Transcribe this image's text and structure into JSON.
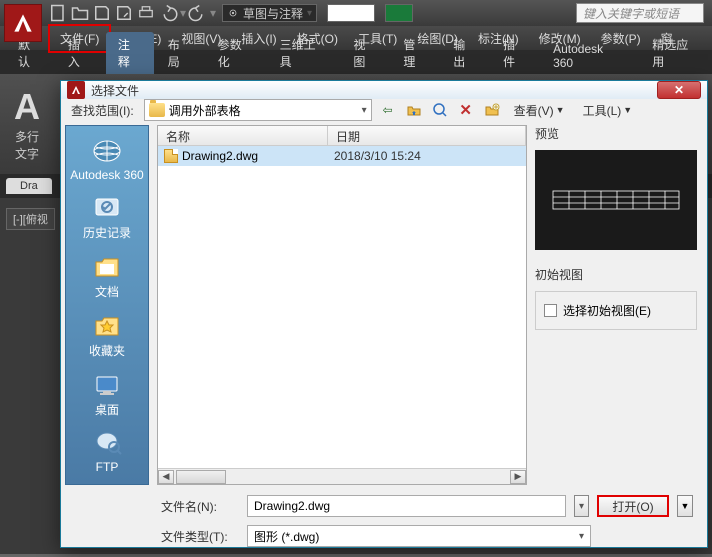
{
  "app": {
    "search_placeholder": "键入关键字或短语",
    "workspace": "草图与注释"
  },
  "menu": [
    "文件(F)",
    "编辑(E)",
    "视图(V)",
    "插入(I)",
    "格式(O)",
    "工具(T)",
    "绘图(D)",
    "标注(N)",
    "修改(M)",
    "参数(P)",
    "窗"
  ],
  "menu_highlight_index": 0,
  "ribbon_tabs": [
    "默认",
    "插入",
    "注释",
    "布局",
    "参数化",
    "三维工具",
    "视图",
    "管理",
    "输出",
    "插件",
    "Autodesk 360",
    "精选应用"
  ],
  "ribbon_active_index": 2,
  "ribbon": {
    "big": "A",
    "l1": "多行",
    "l2": "文字"
  },
  "doctab": "Dra",
  "viewcube": "[-][俯视",
  "dialog": {
    "title": "选择文件",
    "lookin_label": "查找范围(I):",
    "path": "调用外部表格",
    "toolbar": {
      "view": "查看(V)",
      "tools": "工具(L)"
    },
    "columns": {
      "name": "名称",
      "date": "日期"
    },
    "file": {
      "name": "Drawing2.dwg",
      "date": "2018/3/10 15:24"
    },
    "places": [
      "Autodesk 360",
      "历史记录",
      "文档",
      "收藏夹",
      "桌面",
      "FTP"
    ],
    "preview_label": "预览",
    "initview_label": "初始视图",
    "initview_check": "选择初始视图(E)",
    "filename_label": "文件名(N):",
    "filename_value": "Drawing2.dwg",
    "filetype_label": "文件类型(T):",
    "filetype_value": "图形 (*.dwg)",
    "open_btn": "打开(O)"
  }
}
